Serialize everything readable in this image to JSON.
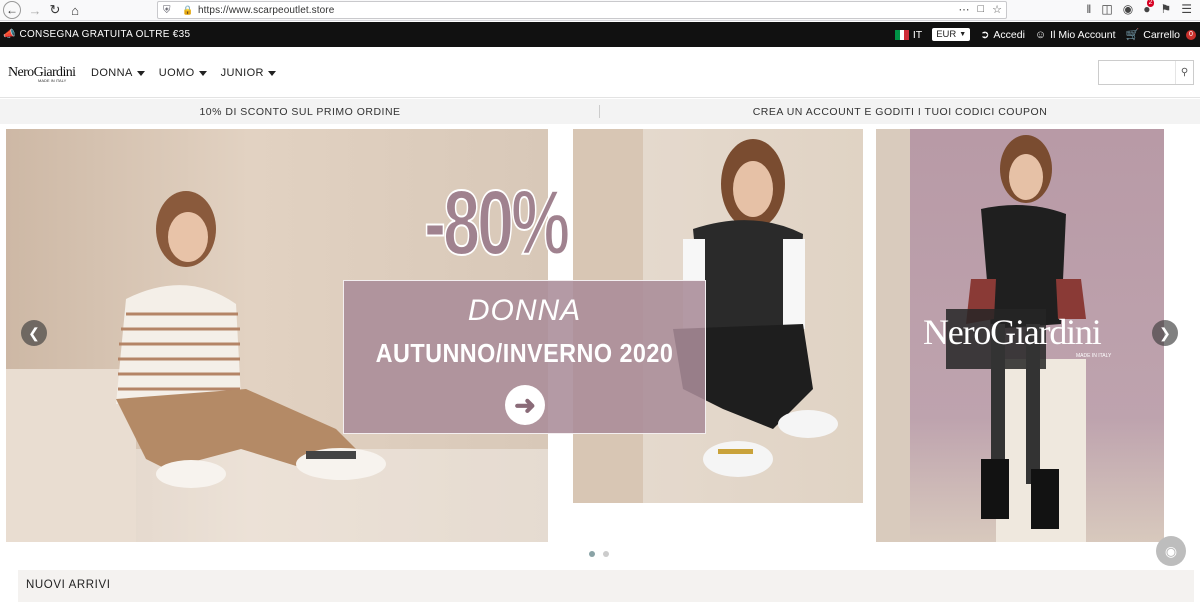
{
  "browser": {
    "url": "https://www.scarpeoutlet.store",
    "ext_badge": "2"
  },
  "topbar": {
    "shipping": "CONSEGNA GRATUITA OLTRE €35",
    "lang": "IT",
    "currency": "EUR",
    "login": "Accedi",
    "account": "Il Mio Account",
    "cart": "Carrello",
    "cart_count": "0"
  },
  "header": {
    "logo": "NeroGiardini",
    "logo_sub": "MADE IN ITALY",
    "nav": [
      {
        "label": "DONNA"
      },
      {
        "label": "UOMO"
      },
      {
        "label": "JUNIOR"
      }
    ],
    "search_placeholder": ""
  },
  "info_strip": {
    "left": "10% DI SCONTO SUL PRIMO ORDINE",
    "right": "CREA UN ACCOUNT E GODITI I TUOI CODICI COUPON"
  },
  "carousel": {
    "discount": "-80%",
    "line1": "DONNA",
    "line2": "AUTUNNO/INVERNO 2020",
    "brand": "NeroGiardini",
    "brand_sub": "MADE IN ITALY",
    "slide_count": 2,
    "active_slide": 1
  },
  "sections": {
    "new_arrivals": "NUOVI ARRIVI"
  },
  "icons": {
    "back": "arrow-left-icon",
    "forward": "arrow-right-icon",
    "reload": "reload-icon",
    "home": "home-icon",
    "cart": "cart-icon",
    "user": "user-icon",
    "login": "login-icon",
    "search": "search-icon"
  },
  "colors": {
    "topbar_bg": "#111111",
    "promo_mauve": "#a0828f",
    "cart_badge": "#c9302c",
    "dot_active": "#8aa3a6"
  }
}
